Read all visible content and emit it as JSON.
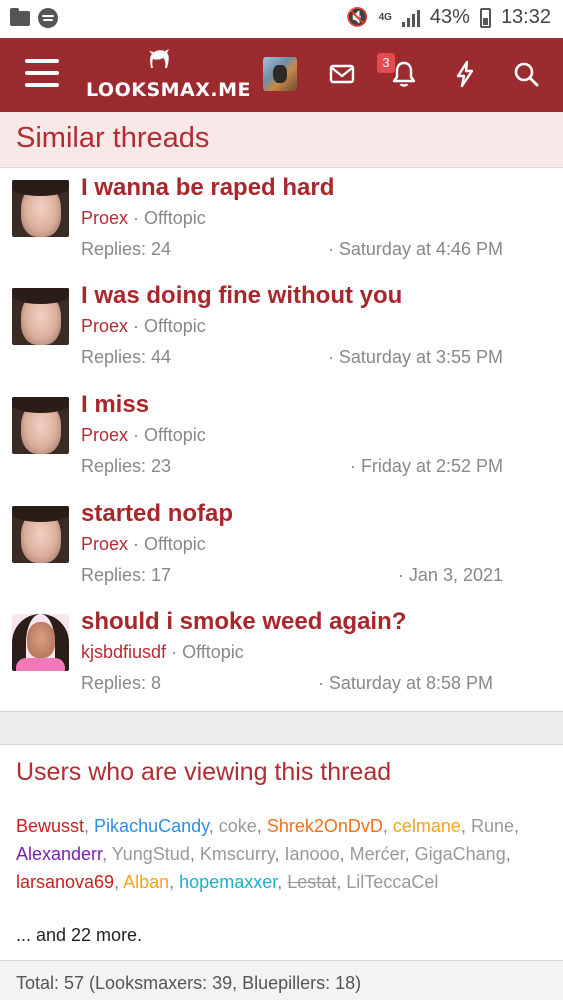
{
  "status_bar": {
    "network": "4G",
    "battery": "43%",
    "time": "13:32"
  },
  "header": {
    "logo_text": "LOOKSMAX.ME",
    "alerts_count": "3",
    "accent_color": "#9c2b30"
  },
  "similar_threads": {
    "heading": "Similar threads",
    "items": [
      {
        "title": "I wanna be raped hard",
        "author": "Proex",
        "forum": "Offtopic",
        "replies": "Replies: 24",
        "date": "Saturday at 4:46 PM"
      },
      {
        "title": "I was doing fine without you",
        "author": "Proex",
        "forum": "Offtopic",
        "replies": "Replies: 44",
        "date": "Saturday at 3:55 PM"
      },
      {
        "title": "I miss",
        "author": "Proex",
        "forum": "Offtopic",
        "replies": "Replies: 23",
        "date": "Friday at 2:52 PM"
      },
      {
        "title": "started nofap",
        "author": "Proex",
        "forum": "Offtopic",
        "replies": "Replies: 17",
        "date": "Jan 3, 2021"
      },
      {
        "title": "should i smoke weed again?",
        "author": "kjsbdfiusdf",
        "forum": "Offtopic",
        "replies": "Replies: 8",
        "date": "Saturday at 8:58 PM"
      }
    ]
  },
  "viewing": {
    "heading": "Users who are viewing this thread",
    "users": [
      "Bewusst",
      "PikachuCandy",
      "coke",
      "Shrek2OnDvD",
      "celmane",
      "Rune",
      "Alexanderr",
      "YungStud",
      "Kmscurry",
      "Ianooo",
      "Merćer",
      "GigaChang",
      "larsanova69",
      "Alban",
      "hopemaxxer",
      "Lestat",
      "LilTeccaCel"
    ],
    "more": "... and 22 more.",
    "total": "Total: 57 (Looksmaxers: 39, Bluepillers: 18)"
  },
  "icons": {
    "menu": "hamburger-icon",
    "logo": "looksmax-logo-icon",
    "inbox": "envelope-icon",
    "alerts": "bell-icon",
    "whats_new": "bolt-icon",
    "search": "search-icon"
  }
}
